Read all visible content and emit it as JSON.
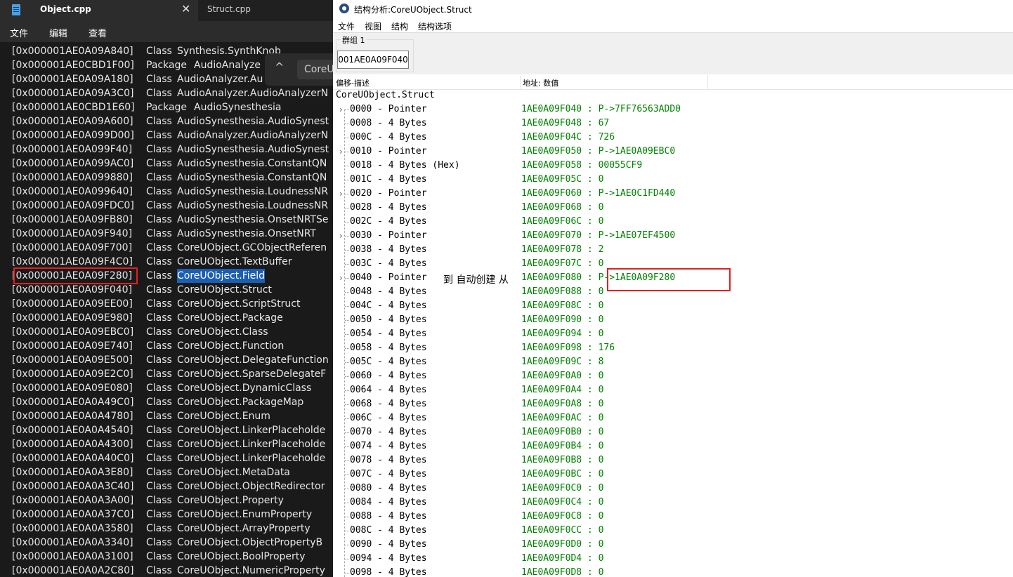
{
  "notepad": {
    "tabs": [
      {
        "label": "Object.cpp",
        "active": true
      },
      {
        "label": "Struct.cpp",
        "active": false
      }
    ],
    "close_glyph": "✕",
    "menu": [
      "文件",
      "编辑",
      "查看"
    ],
    "find": {
      "value": "CoreU",
      "chevron": "^"
    },
    "lines": [
      {
        "addr": "[0x000001AE0A09A840]",
        "kind": "Class",
        "name": "Synthesis.SynthKnob"
      },
      {
        "addr": "[0x000001AE0CBD1F00]",
        "kind": "Package",
        "name": "AudioAnalyze"
      },
      {
        "addr": "[0x000001AE0A09A180]",
        "kind": "Class",
        "name": "AudioAnalyzer.Au"
      },
      {
        "addr": "[0x000001AE0A09A3C0]",
        "kind": "Class",
        "name": "AudioAnalyzer.AudioAnalyzerN"
      },
      {
        "addr": "[0x000001AE0CBD1E60]",
        "kind": "Package",
        "name": "AudioSynesthesia"
      },
      {
        "addr": "[0x000001AE0A09A600]",
        "kind": "Class",
        "name": "AudioSynesthesia.AudioSynest"
      },
      {
        "addr": "[0x000001AE0A099D00]",
        "kind": "Class",
        "name": "AudioAnalyzer.AudioAnalyzerN"
      },
      {
        "addr": "[0x000001AE0A099F40]",
        "kind": "Class",
        "name": "AudioSynesthesia.AudioSynest"
      },
      {
        "addr": "[0x000001AE0A099AC0]",
        "kind": "Class",
        "name": "AudioSynesthesia.ConstantQN"
      },
      {
        "addr": "[0x000001AE0A099880]",
        "kind": "Class",
        "name": "AudioSynesthesia.ConstantQN"
      },
      {
        "addr": "[0x000001AE0A099640]",
        "kind": "Class",
        "name": "AudioSynesthesia.LoudnessNR"
      },
      {
        "addr": "[0x000001AE0A09FDC0]",
        "kind": "Class",
        "name": "AudioSynesthesia.LoudnessNR"
      },
      {
        "addr": "[0x000001AE0A09FB80]",
        "kind": "Class",
        "name": "AudioSynesthesia.OnsetNRTSe"
      },
      {
        "addr": "[0x000001AE0A09F940]",
        "kind": "Class",
        "name": "AudioSynesthesia.OnsetNRT"
      },
      {
        "addr": "[0x000001AE0A09F700]",
        "kind": "Class",
        "name": "CoreUObject.GCObjectReferen"
      },
      {
        "addr": "[0x000001AE0A09F4C0]",
        "kind": "Class",
        "name": "CoreUObject.TextBuffer"
      },
      {
        "addr": "[0x000001AE0A09F280]",
        "kind": "Class",
        "name": "CoreUObject.Field",
        "highlight": true,
        "selected": true
      },
      {
        "addr": "[0x000001AE0A09F040]",
        "kind": "Class",
        "name": "CoreUObject.Struct"
      },
      {
        "addr": "[0x000001AE0A09EE00]",
        "kind": "Class",
        "name": "CoreUObject.ScriptStruct"
      },
      {
        "addr": "[0x000001AE0A09E980]",
        "kind": "Class",
        "name": "CoreUObject.Package"
      },
      {
        "addr": "[0x000001AE0A09EBC0]",
        "kind": "Class",
        "name": "CoreUObject.Class"
      },
      {
        "addr": "[0x000001AE0A09E740]",
        "kind": "Class",
        "name": "CoreUObject.Function"
      },
      {
        "addr": "[0x000001AE0A09E500]",
        "kind": "Class",
        "name": "CoreUObject.DelegateFunction"
      },
      {
        "addr": "[0x000001AE0A09E2C0]",
        "kind": "Class",
        "name": "CoreUObject.SparseDelegateF"
      },
      {
        "addr": "[0x000001AE0A09E080]",
        "kind": "Class",
        "name": "CoreUObject.DynamicClass"
      },
      {
        "addr": "[0x000001AE0A0A49C0]",
        "kind": "Class",
        "name": "CoreUObject.PackageMap"
      },
      {
        "addr": "[0x000001AE0A0A4780]",
        "kind": "Class",
        "name": "CoreUObject.Enum"
      },
      {
        "addr": "[0x000001AE0A0A4540]",
        "kind": "Class",
        "name": "CoreUObject.LinkerPlaceholde"
      },
      {
        "addr": "[0x000001AE0A0A4300]",
        "kind": "Class",
        "name": "CoreUObject.LinkerPlaceholde"
      },
      {
        "addr": "[0x000001AE0A0A40C0]",
        "kind": "Class",
        "name": "CoreUObject.LinkerPlaceholde"
      },
      {
        "addr": "[0x000001AE0A0A3E80]",
        "kind": "Class",
        "name": "CoreUObject.MetaData"
      },
      {
        "addr": "[0x000001AE0A0A3C40]",
        "kind": "Class",
        "name": "CoreUObject.ObjectRedirector"
      },
      {
        "addr": "[0x000001AE0A0A3A00]",
        "kind": "Class",
        "name": "CoreUObject.Property"
      },
      {
        "addr": "[0x000001AE0A0A37C0]",
        "kind": "Class",
        "name": "CoreUObject.EnumProperty"
      },
      {
        "addr": "[0x000001AE0A0A3580]",
        "kind": "Class",
        "name": "CoreUObject.ArrayProperty"
      },
      {
        "addr": "[0x000001AE0A0A3340]",
        "kind": "Class",
        "name": "CoreUObject.ObjectPropertyB"
      },
      {
        "addr": "[0x000001AE0A0A3100]",
        "kind": "Class",
        "name": "CoreUObject.BoolProperty"
      },
      {
        "addr": "[0x000001AE0A0A2C80]",
        "kind": "Class",
        "name": "CoreUObject.NumericProperty"
      }
    ]
  },
  "struct_window": {
    "title": "结构分析:CoreUObject.Struct",
    "menu": [
      "文件",
      "视图",
      "结构",
      "结构选项"
    ],
    "group_label": "群组 1",
    "address_value": "001AE0A09F040",
    "columns": [
      "偏移-描述",
      "地址: 数值"
    ],
    "root": "CoreUObject.Struct",
    "annotation": "到  自动创建  从",
    "expand_glyph": "›",
    "rows": [
      {
        "desc": "0000 - Pointer",
        "val": "1AE0A09F040 : P->7FF76563ADD0",
        "expandable": true
      },
      {
        "desc": "0008 - 4 Bytes",
        "val": "1AE0A09F048 : 67"
      },
      {
        "desc": "000C - 4 Bytes",
        "val": "1AE0A09F04C : 726"
      },
      {
        "desc": "0010 - Pointer",
        "val": "1AE0A09F050 : P->1AE0A09EBC0",
        "expandable": true
      },
      {
        "desc": "0018 - 4 Bytes (Hex)",
        "val": "1AE0A09F058 : 00055CF9"
      },
      {
        "desc": "001C - 4 Bytes",
        "val": "1AE0A09F05C : 0"
      },
      {
        "desc": "0020 - Pointer",
        "val": "1AE0A09F060 : P->1AE0C1FD440",
        "expandable": true
      },
      {
        "desc": "0028 - 4 Bytes",
        "val": "1AE0A09F068 : 0"
      },
      {
        "desc": "002C - 4 Bytes",
        "val": "1AE0A09F06C : 0"
      },
      {
        "desc": "0030 - Pointer",
        "val": "1AE0A09F070 : P->1AE07EF4500",
        "expandable": true
      },
      {
        "desc": "0038 - 4 Bytes",
        "val": "1AE0A09F078 : 2"
      },
      {
        "desc": "003C - 4 Bytes",
        "val": "1AE0A09F07C : 0"
      },
      {
        "desc": "0040 - Pointer",
        "val": "1AE0A09F080 : P->1AE0A09F280",
        "expandable": true,
        "highlight": true
      },
      {
        "desc": "0048 - 4 Bytes",
        "val": "1AE0A09F088 : 0"
      },
      {
        "desc": "004C - 4 Bytes",
        "val": "1AE0A09F08C : 0"
      },
      {
        "desc": "0050 - 4 Bytes",
        "val": "1AE0A09F090 : 0"
      },
      {
        "desc": "0054 - 4 Bytes",
        "val": "1AE0A09F094 : 0"
      },
      {
        "desc": "0058 - 4 Bytes",
        "val": "1AE0A09F098 : 176"
      },
      {
        "desc": "005C - 4 Bytes",
        "val": "1AE0A09F09C : 8"
      },
      {
        "desc": "0060 - 4 Bytes",
        "val": "1AE0A09F0A0 : 0"
      },
      {
        "desc": "0064 - 4 Bytes",
        "val": "1AE0A09F0A4 : 0"
      },
      {
        "desc": "0068 - 4 Bytes",
        "val": "1AE0A09F0A8 : 0"
      },
      {
        "desc": "006C - 4 Bytes",
        "val": "1AE0A09F0AC : 0"
      },
      {
        "desc": "0070 - 4 Bytes",
        "val": "1AE0A09F0B0 : 0"
      },
      {
        "desc": "0074 - 4 Bytes",
        "val": "1AE0A09F0B4 : 0"
      },
      {
        "desc": "0078 - 4 Bytes",
        "val": "1AE0A09F0B8 : 0"
      },
      {
        "desc": "007C - 4 Bytes",
        "val": "1AE0A09F0BC : 0"
      },
      {
        "desc": "0080 - 4 Bytes",
        "val": "1AE0A09F0C0 : 0"
      },
      {
        "desc": "0084 - 4 Bytes",
        "val": "1AE0A09F0C4 : 0"
      },
      {
        "desc": "0088 - 4 Bytes",
        "val": "1AE0A09F0C8 : 0"
      },
      {
        "desc": "008C - 4 Bytes",
        "val": "1AE0A09F0CC : 0"
      },
      {
        "desc": "0090 - 4 Bytes",
        "val": "1AE0A09F0D0 : 0"
      },
      {
        "desc": "0094 - 4 Bytes",
        "val": "1AE0A09F0D4 : 0"
      },
      {
        "desc": "0098 - 4 Bytes",
        "val": "1AE0A09F0D8 : 0"
      }
    ]
  },
  "colors": {
    "highlight_box": "#e02020",
    "selection": "#1a5fb4",
    "value_text": "#008000"
  }
}
